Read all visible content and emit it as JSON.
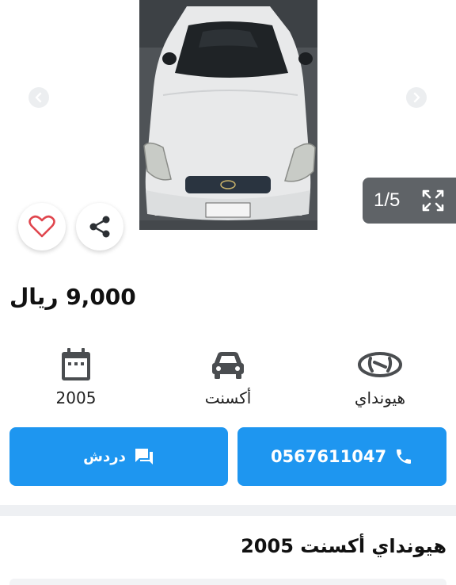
{
  "gallery": {
    "counter": "1/5",
    "icons": {
      "prev": "chevron-left-icon",
      "next": "chevron-right-icon",
      "expand": "expand-icon",
      "favorite": "heart-icon",
      "share": "share-icon"
    }
  },
  "listing": {
    "price": "9,000 ريال",
    "specs": {
      "year": "2005",
      "model": "أكسنت",
      "brand": "هيونداي"
    },
    "call_label": "0567611047",
    "chat_label": "دردش",
    "title": "هيونداي أكسنت 2005"
  },
  "colors": {
    "accent": "#1e96f0",
    "heart": "#e0454d",
    "counter_bg": "#5f6367"
  }
}
